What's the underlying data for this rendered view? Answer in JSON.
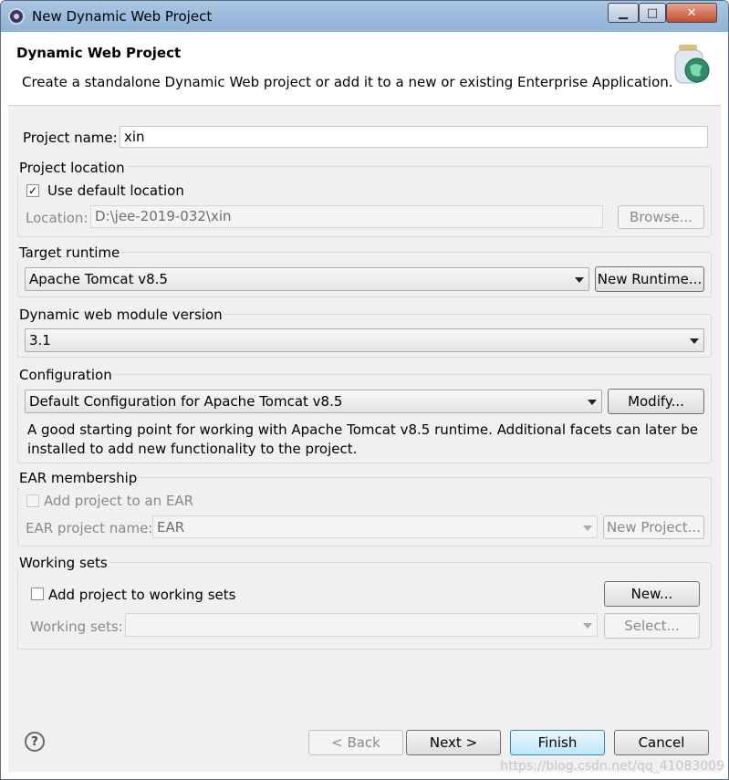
{
  "window": {
    "title": "New Dynamic Web Project",
    "controls": {
      "minimize": "▁",
      "maximize": "□",
      "close": "✕"
    }
  },
  "header": {
    "title": "Dynamic Web Project",
    "description": "Create a standalone Dynamic Web project or add it to a new or existing Enterprise Application."
  },
  "project_name": {
    "label": "Project name:",
    "value": "xin"
  },
  "project_location": {
    "group_title": "Project location",
    "use_default_label": "Use default location",
    "use_default_checked": true,
    "location_label": "Location:",
    "location_value": "D:\\jee-2019-032\\xin",
    "browse_label": "Browse..."
  },
  "target_runtime": {
    "group_title": "Target runtime",
    "selected": "Apache Tomcat v8.5",
    "new_runtime_label": "New Runtime..."
  },
  "module_version": {
    "group_title": "Dynamic web module version",
    "selected": "3.1"
  },
  "configuration": {
    "group_title": "Configuration",
    "selected": "Default Configuration for Apache Tomcat v8.5",
    "modify_label": "Modify...",
    "description_line1": "A good starting point for working with Apache Tomcat v8.5 runtime. Additional facets can later be",
    "description_line2": "installed to add new functionality to the project."
  },
  "ear_membership": {
    "group_title": "EAR membership",
    "add_label": "Add project to an EAR",
    "add_checked": false,
    "ear_name_label": "EAR project name:",
    "ear_name_value": "EAR",
    "new_project_label": "New Project..."
  },
  "working_sets": {
    "group_title": "Working sets",
    "add_label": "Add project to working sets",
    "add_checked": false,
    "new_label": "New...",
    "sets_label": "Working sets:",
    "sets_value": "",
    "select_label": "Select..."
  },
  "footer": {
    "help": "?",
    "back_label": "< Back",
    "next_label": "Next >",
    "finish_label": "Finish",
    "cancel_label": "Cancel"
  },
  "watermark": "https://blog.csdn.net/qq_41083009"
}
